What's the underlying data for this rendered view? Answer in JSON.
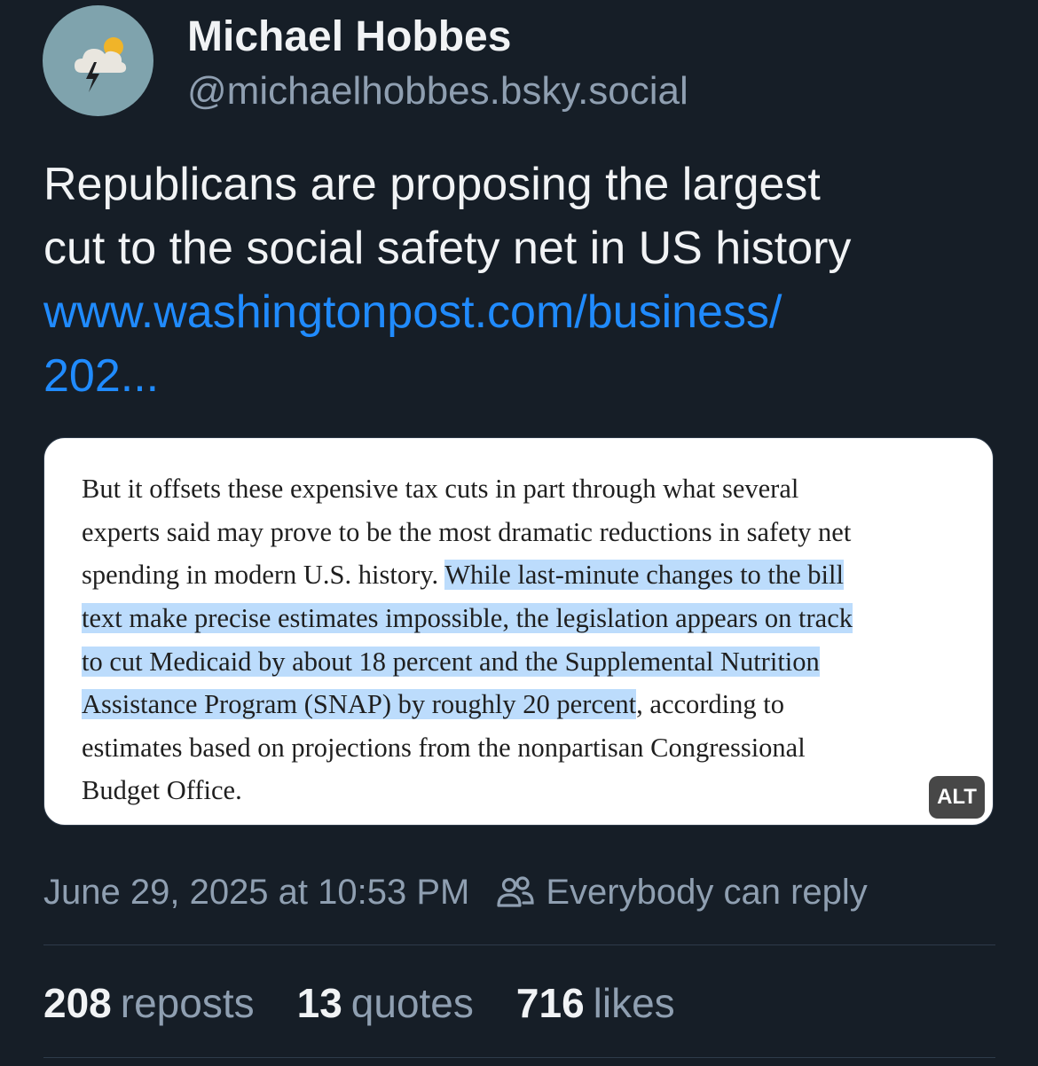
{
  "author": {
    "display_name": "Michael Hobbes",
    "handle": "@michaelhobbes.bsky.social",
    "avatar_icon": "storm-cloud-icon",
    "avatar_bg": "#7fa3ad"
  },
  "post": {
    "text_lines": [
      "Republicans are proposing the largest",
      "cut to the social safety net in US history"
    ],
    "link_lines": [
      "www.washingtonpost.com/business/",
      "202..."
    ],
    "link_color": "#208bfe"
  },
  "embed_image": {
    "lines": [
      {
        "plain": "But it offsets these expensive tax cuts in part through what several",
        "highlight": "",
        "after": ""
      },
      {
        "plain": "experts said may prove to be the most dramatic reductions in safety net",
        "highlight": "",
        "after": ""
      },
      {
        "plain": "spending in modern U.S. history. ",
        "highlight": "While last-minute changes to the bill",
        "after": ""
      },
      {
        "plain": "",
        "highlight": "text make precise estimates impossible, the legislation appears on track",
        "after": ""
      },
      {
        "plain": "",
        "highlight": "to cut Medicaid by about 18 percent and the Supplemental Nutrition",
        "after": ""
      },
      {
        "plain": "",
        "highlight": "Assistance Program (SNAP) by roughly 20 percent",
        "after": ", according to"
      },
      {
        "plain": "estimates based on projections from the nonpartisan Congressional",
        "highlight": "",
        "after": ""
      },
      {
        "plain": "Budget Office.",
        "highlight": "",
        "after": ""
      }
    ],
    "alt_badge": "ALT",
    "highlight_color": "#bcdcfc"
  },
  "meta": {
    "timestamp": "June 29, 2025 at 10:53 PM",
    "reply_setting_icon": "people-icon",
    "reply_setting": "Everybody can reply"
  },
  "stats": {
    "reposts_count": "208",
    "reposts_label": "reposts",
    "quotes_count": "13",
    "quotes_label": "quotes",
    "likes_count": "716",
    "likes_label": "likes"
  }
}
